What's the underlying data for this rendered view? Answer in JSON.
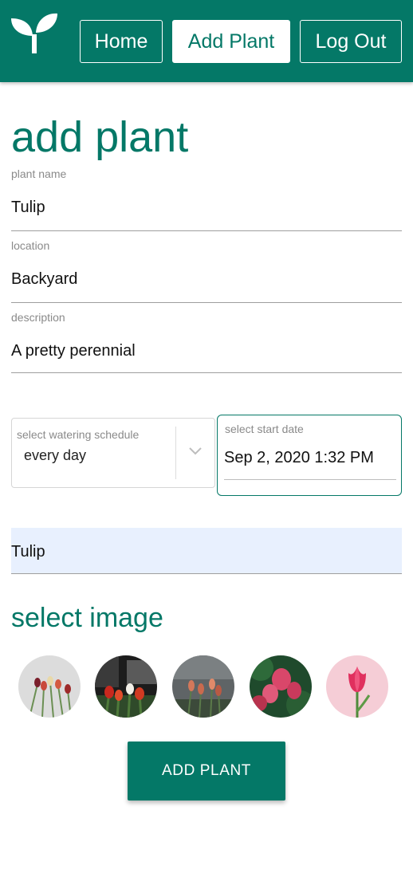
{
  "navbar": {
    "logo_icon": "sprout-icon",
    "brand_color": "#047867",
    "links": [
      {
        "label": "Home",
        "active": false
      },
      {
        "label": "Add Plant",
        "active": true
      },
      {
        "label": "Log Out",
        "active": false
      }
    ]
  },
  "page": {
    "title": "add plant"
  },
  "form": {
    "plant_name": {
      "label": "plant name",
      "value": "Tulip"
    },
    "location": {
      "label": "location",
      "value": "Backyard"
    },
    "description": {
      "label": "description",
      "value": "A pretty perennial"
    },
    "watering": {
      "label": "select watering schedule",
      "value": "every day",
      "icon": "chevron-down-icon"
    },
    "start_date": {
      "label": "select start date",
      "value": "Sep 2, 2020 1:32 PM"
    },
    "autofill_value": "Tulip"
  },
  "images": {
    "title": "select image",
    "options": [
      {
        "name": "tulips-white-bg"
      },
      {
        "name": "tulips-dark-bg"
      },
      {
        "name": "tulips-grey-bg"
      },
      {
        "name": "tulips-green-bg"
      },
      {
        "name": "tulip-pink-bg"
      }
    ]
  },
  "submit": {
    "label": "ADD PLANT"
  }
}
